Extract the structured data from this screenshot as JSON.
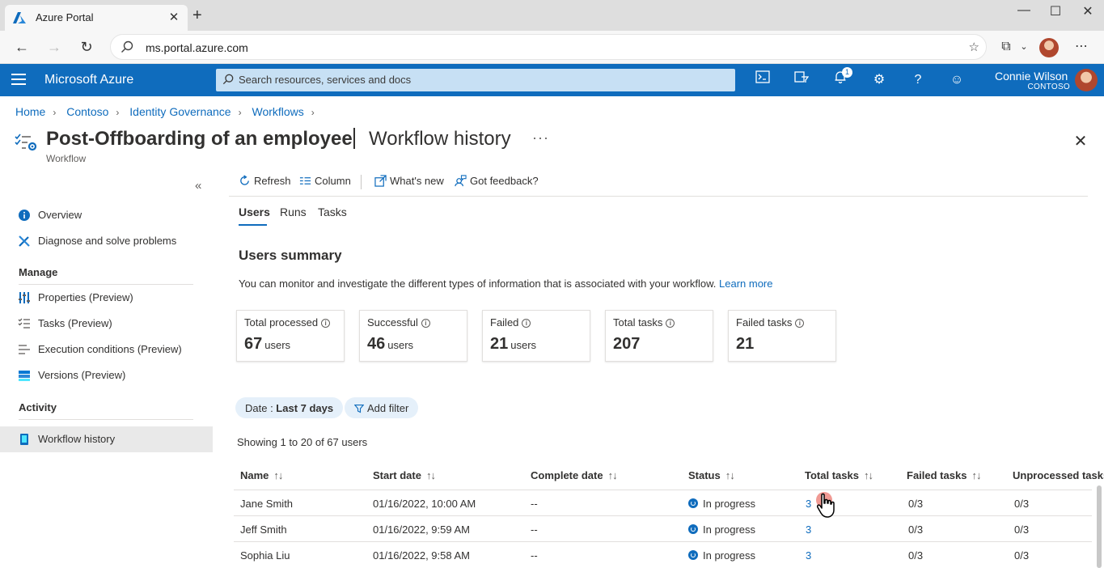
{
  "browser": {
    "tab_title": "Azure Portal",
    "url": "ms.portal.azure.com"
  },
  "header": {
    "brand": "Microsoft Azure",
    "search_placeholder": "Search resources, services and docs",
    "notifications_count": "1",
    "user_name": "Connie Wilson",
    "user_org": "CONTOSO"
  },
  "breadcrumb": [
    "Home",
    "Contoso",
    "Identity Governance",
    "Workflows"
  ],
  "title": {
    "main": "Post-Offboarding of an employee",
    "sub": "Workflow history",
    "type": "Workflow"
  },
  "sidebar": {
    "items_top": [
      {
        "label": "Overview",
        "icon": "info-icon"
      },
      {
        "label": "Diagnose and solve problems",
        "icon": "wrench-icon"
      }
    ],
    "manage_heading": "Manage",
    "manage_items": [
      {
        "label": "Properties (Preview)",
        "icon": "properties-icon"
      },
      {
        "label": "Tasks (Preview)",
        "icon": "tasks-icon"
      },
      {
        "label": "Execution conditions (Preview)",
        "icon": "conditions-icon"
      },
      {
        "label": "Versions (Preview)",
        "icon": "versions-icon"
      }
    ],
    "activity_heading": "Activity",
    "activity_items": [
      {
        "label": "Workflow history",
        "icon": "history-icon",
        "active": true
      }
    ]
  },
  "toolbar": {
    "refresh": "Refresh",
    "column": "Column",
    "whats_new": "What's new",
    "feedback": "Got feedback?"
  },
  "tabs": [
    "Users",
    "Runs",
    "Tasks"
  ],
  "summary": {
    "title": "Users summary",
    "description": "You can monitor and investigate the different types of information that is associated with your workflow.",
    "learn_more": "Learn more",
    "cards": [
      {
        "label": "Total processed",
        "value": "67",
        "unit": "users"
      },
      {
        "label": "Successful",
        "value": "46",
        "unit": "users"
      },
      {
        "label": "Failed",
        "value": "21",
        "unit": "users"
      },
      {
        "label": "Total tasks",
        "value": "207",
        "unit": ""
      },
      {
        "label": "Failed tasks",
        "value": "21",
        "unit": ""
      }
    ]
  },
  "filters": {
    "date_label": "Date : ",
    "date_value": "Last 7 days",
    "add_filter": "Add filter"
  },
  "showing": "Showing 1 to 20 of 67 users",
  "table": {
    "columns": [
      "Name",
      "Start date",
      "Complete date",
      "Status",
      "Total tasks",
      "Failed tasks",
      "Unprocessed tasks"
    ],
    "rows": [
      {
        "name": "Jane Smith",
        "start": "01/16/2022, 10:00 AM",
        "complete": "--",
        "status": "In progress",
        "total": "3",
        "failed": "0/3",
        "unprocessed": "0/3"
      },
      {
        "name": "Jeff Smith",
        "start": "01/16/2022, 9:59 AM",
        "complete": "--",
        "status": "In progress",
        "total": "3",
        "failed": "0/3",
        "unprocessed": "0/3"
      },
      {
        "name": "Sophia Liu",
        "start": "01/16/2022, 9:58 AM",
        "complete": "--",
        "status": "In progress",
        "total": "3",
        "failed": "0/3",
        "unprocessed": "0/3"
      }
    ]
  }
}
